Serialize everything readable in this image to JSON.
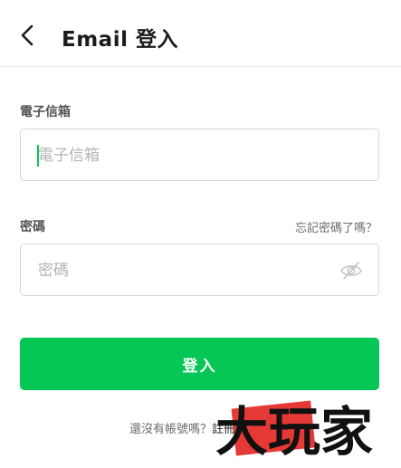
{
  "header": {
    "title": "Email 登入",
    "back_icon": "chevron-left-icon"
  },
  "email": {
    "label": "電子信箱",
    "placeholder": "電子信箱"
  },
  "password": {
    "label": "密碼",
    "placeholder": "密碼",
    "forgot_link": "忘記密碼了嗎？",
    "toggle_icon": "eye-off-icon"
  },
  "login_button": {
    "label": "登入"
  },
  "signup": {
    "prompt": "還沒有帳號嗎？",
    "link": "註冊"
  },
  "watermark": {
    "text": "大玩家"
  },
  "colors": {
    "accent": "#06c755",
    "watermark_red": "#e53935"
  }
}
